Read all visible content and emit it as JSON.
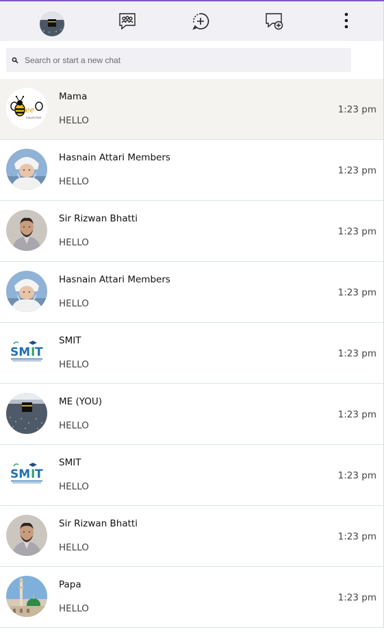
{
  "header": {
    "profile_avatar": "kaaba-crowd-avatar",
    "icons": [
      "communities-icon",
      "status-icon",
      "new-chat-icon",
      "menu-dots-icon"
    ],
    "accent_color": "#7e57c2"
  },
  "search": {
    "placeholder": "Search or start a new chat"
  },
  "chats": [
    {
      "name": "Mama",
      "message": "HELLO",
      "time": "1:23 pm",
      "avatar": "bee-collective-logo",
      "active": true
    },
    {
      "name": "Hasnain Attari Members",
      "message": "HELLO",
      "time": "1:23 pm",
      "avatar": "elder-white-turban-photo",
      "active": false
    },
    {
      "name": "Sir Rizwan Bhatti",
      "message": "HELLO",
      "time": "1:23 pm",
      "avatar": "man-portrait-photo",
      "active": false
    },
    {
      "name": "Hasnain Attari Members",
      "message": "HELLO",
      "time": "1:23 pm",
      "avatar": "elder-white-turban-photo",
      "active": false
    },
    {
      "name": "SMIT",
      "message": "HELLO",
      "time": "1:23 pm",
      "avatar": "smit-logo",
      "active": false
    },
    {
      "name": "ME (YOU)",
      "message": "HELLO",
      "time": "1:23 pm",
      "avatar": "kaaba-crowd-photo",
      "active": false
    },
    {
      "name": "SMIT",
      "message": "HELLO",
      "time": "1:23 pm",
      "avatar": "smit-logo",
      "active": false
    },
    {
      "name": "Sir Rizwan Bhatti",
      "message": "HELLO",
      "time": "1:23 pm",
      "avatar": "man-portrait-photo",
      "active": false
    },
    {
      "name": "Papa",
      "message": "HELLO",
      "time": "1:23 pm",
      "avatar": "green-dome-mosque-photo",
      "active": false
    }
  ]
}
